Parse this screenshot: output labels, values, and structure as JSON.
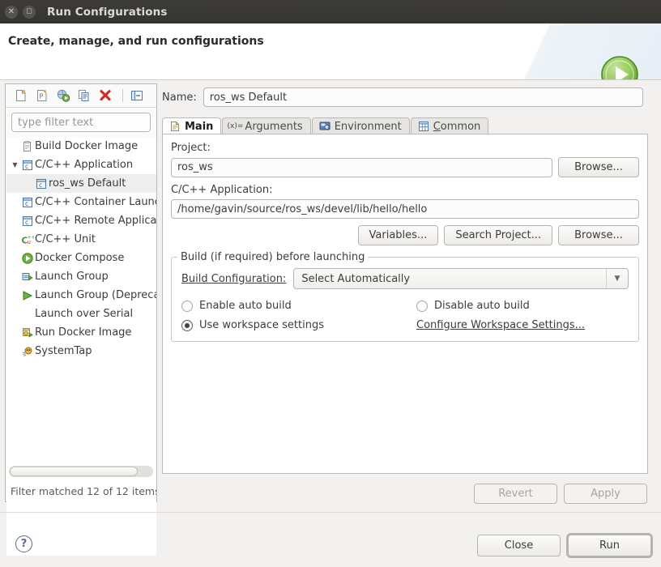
{
  "window": {
    "title": "Run Configurations",
    "close_icon": "close-icon",
    "maximize_icon": "maximize-icon"
  },
  "header": {
    "title": "Create, manage, and run configurations",
    "badge_icon": "run-play-icon"
  },
  "left_panel": {
    "toolbar": [
      {
        "name": "new-configuration-button",
        "icon": "new-document-icon"
      },
      {
        "name": "new-prototype-button",
        "icon": "new-prototype-icon"
      },
      {
        "name": "new-launch-group-button",
        "icon": "new-launch-group-icon"
      },
      {
        "name": "duplicate-button",
        "icon": "duplicate-icon"
      },
      {
        "name": "delete-button",
        "icon": "delete-x-icon"
      },
      {
        "name": "collapse-all-button",
        "icon": "collapse-all-icon"
      }
    ],
    "filter": {
      "placeholder": "type filter text",
      "value": ""
    },
    "tree": [
      {
        "label": "Build Docker Image",
        "icon": "docker-build-icon",
        "indent": 0,
        "arrow": "",
        "selected": false
      },
      {
        "label": "C/C++ Application",
        "icon": "c-app-icon",
        "indent": 0,
        "arrow": "expanded",
        "selected": false
      },
      {
        "label": "ros_ws Default",
        "icon": "c-app-icon",
        "indent": 1,
        "arrow": "",
        "selected": true
      },
      {
        "label": "C/C++ Container Launc",
        "icon": "c-app-icon",
        "indent": 0,
        "arrow": "",
        "selected": false
      },
      {
        "label": "C/C++ Remote Applicat",
        "icon": "c-app-icon",
        "indent": 0,
        "arrow": "",
        "selected": false
      },
      {
        "label": "C/C++ Unit",
        "icon": "cpp-unit-icon",
        "indent": 0,
        "arrow": "",
        "selected": false
      },
      {
        "label": "Docker Compose",
        "icon": "docker-compose-icon",
        "indent": 0,
        "arrow": "",
        "selected": false
      },
      {
        "label": "Launch Group",
        "icon": "launch-group-icon",
        "indent": 0,
        "arrow": "",
        "selected": false
      },
      {
        "label": "Launch Group (Depreca",
        "icon": "launch-group-deprecated-icon",
        "indent": 0,
        "arrow": "",
        "selected": false
      },
      {
        "label": "Launch over Serial",
        "icon": "",
        "indent": 0,
        "arrow": "",
        "selected": false
      },
      {
        "label": "Run Docker Image",
        "icon": "run-docker-icon",
        "indent": 0,
        "arrow": "",
        "selected": false
      },
      {
        "label": "SystemTap",
        "icon": "systemtap-icon",
        "indent": 0,
        "arrow": "",
        "selected": false
      }
    ],
    "filter_status": "Filter matched 12 of 12 items"
  },
  "main": {
    "name_label": "Name:",
    "name_value": "ros_ws Default",
    "tabs": [
      {
        "label": "Main",
        "icon": "document-icon",
        "active": true,
        "mnemonic": ""
      },
      {
        "label": "Arguments",
        "icon": "arguments-icon",
        "active": false,
        "mnemonic": ""
      },
      {
        "label": "Environment",
        "icon": "environment-icon",
        "active": false,
        "mnemonic": ""
      },
      {
        "label": "Common",
        "icon": "common-table-icon",
        "active": false,
        "mnemonic": "C"
      }
    ],
    "project_label": "Project:",
    "project_value": "ros_ws",
    "project_browse_label": "Browse...",
    "application_label": "C/C++ Application:",
    "application_value": "/home/gavin/source/ros_ws/devel/lib/hello/hello",
    "variables_label": "Variables...",
    "search_project_label": "Search Project...",
    "app_browse_label": "Browse...",
    "build_group": {
      "title": "Build (if required) before launching",
      "build_configuration_label": "Build Configuration:",
      "build_configuration_value": "Select Automatically",
      "options": [
        {
          "label": "Enable auto build",
          "selected": false,
          "name": "radio-enable-auto-build"
        },
        {
          "label": "Disable auto build",
          "selected": false,
          "name": "radio-disable-auto-build"
        },
        {
          "label": "Use workspace settings",
          "selected": true,
          "name": "radio-use-workspace-settings"
        }
      ],
      "configure_link": "Configure Workspace Settings..."
    },
    "revert_label": "Revert",
    "apply_label": "Apply",
    "revert_enabled": false,
    "apply_enabled": false
  },
  "footer": {
    "help_icon": "help-icon",
    "close_label": "Close",
    "run_label": "Run"
  },
  "colors": {
    "titlebar": "#3c3b37",
    "accent_green": "#72b13a",
    "delete_red": "#cf2a27",
    "dialog_bg": "#f2f1f0"
  }
}
